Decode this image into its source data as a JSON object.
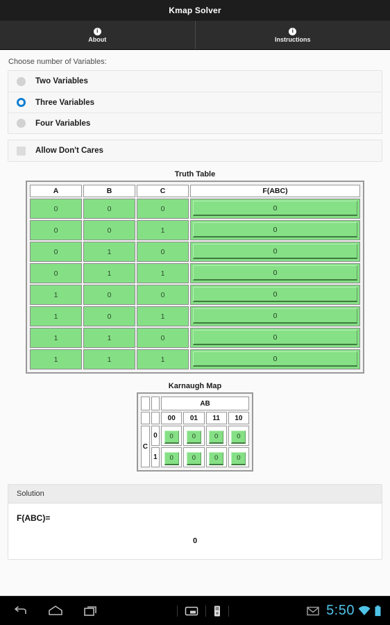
{
  "app": {
    "title": "Kmap Solver"
  },
  "tabs": [
    {
      "label": "About",
      "icon": "info-icon",
      "glyph": "i"
    },
    {
      "label": "Instructions",
      "icon": "info-icon",
      "glyph": "i"
    }
  ],
  "options": {
    "prompt": "Choose number of Variables:",
    "radios": [
      {
        "label": "Two Variables",
        "selected": false
      },
      {
        "label": "Three Variables",
        "selected": true
      },
      {
        "label": "Four Variables",
        "selected": false
      }
    ],
    "checkbox": {
      "label": "Allow Don't Cares",
      "checked": false
    }
  },
  "truth_table": {
    "caption": "Truth Table",
    "headers": [
      "A",
      "B",
      "C",
      "F(ABC)"
    ],
    "rows": [
      {
        "a": "0",
        "b": "0",
        "c": "0",
        "f": "0"
      },
      {
        "a": "0",
        "b": "0",
        "c": "1",
        "f": "0"
      },
      {
        "a": "0",
        "b": "1",
        "c": "0",
        "f": "0"
      },
      {
        "a": "0",
        "b": "1",
        "c": "1",
        "f": "0"
      },
      {
        "a": "1",
        "b": "0",
        "c": "0",
        "f": "0"
      },
      {
        "a": "1",
        "b": "0",
        "c": "1",
        "f": "0"
      },
      {
        "a": "1",
        "b": "1",
        "c": "0",
        "f": "0"
      },
      {
        "a": "1",
        "b": "1",
        "c": "1",
        "f": "0"
      }
    ]
  },
  "karnaugh_map": {
    "caption": "Karnaugh Map",
    "col_group_label": "AB",
    "col_headers": [
      "00",
      "01",
      "11",
      "10"
    ],
    "row_var_label": "C",
    "row_headers": [
      "0",
      "1"
    ],
    "cells": [
      [
        "0",
        "0",
        "0",
        "0"
      ],
      [
        "0",
        "0",
        "0",
        "0"
      ]
    ]
  },
  "solution": {
    "header": "Solution",
    "equation": "F(ABC)=",
    "value": "0"
  },
  "navbar": {
    "back": "back-icon",
    "home": "home-icon",
    "recents": "recents-icon",
    "notif1": "screenshot-icon",
    "notif2": "usb-storage-icon",
    "mail": "gmail-icon",
    "time": "5:50",
    "wifi": "wifi-icon",
    "battery": "battery-icon"
  },
  "colors": {
    "accent_blue": "#0f7fd4",
    "cell_green": "#85e085",
    "clock_blue": "#4fc3e8",
    "titlebar": "#1d1d1d"
  }
}
